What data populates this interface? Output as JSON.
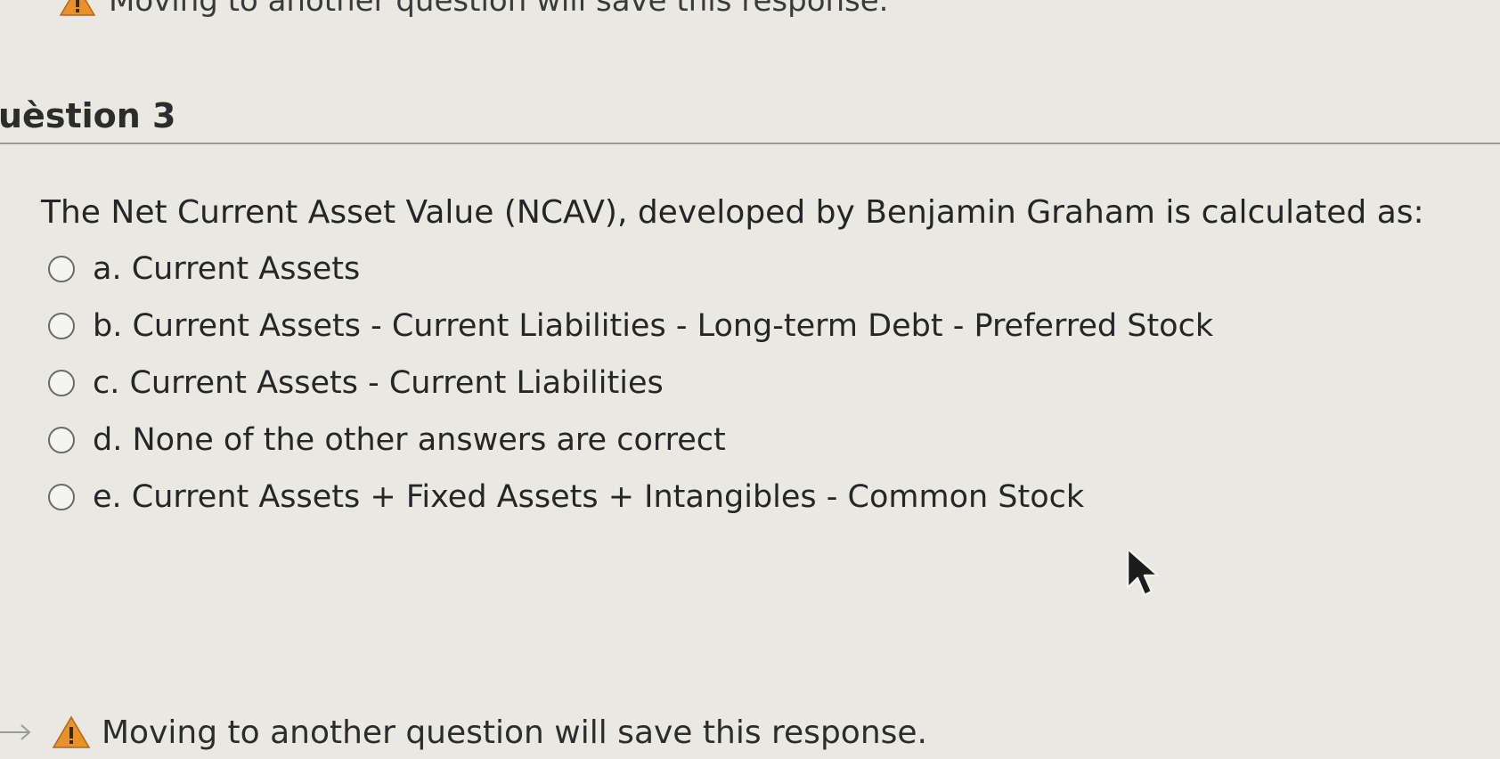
{
  "top_warning": {
    "icon": "warning-triangle-icon",
    "text": "Moving to another question will save this response."
  },
  "question": {
    "title": "uèstion 3",
    "text": "The Net Current Asset Value (NCAV), developed by Benjamin Graham is calculated as:",
    "options": [
      {
        "label": "a. Current Assets"
      },
      {
        "label": "b. Current Assets - Current Liabilities - Long-term Debt - Preferred Stock"
      },
      {
        "label": "c. Current Assets - Current Liabilities"
      },
      {
        "label": "d. None of the other answers are correct"
      },
      {
        "label": "e. Current Assets + Fixed Assets + Intangibles - Common Stock"
      }
    ]
  },
  "bottom_warning": {
    "icon": "warning-triangle-icon",
    "text": "Moving to another question will save this response."
  },
  "colors": {
    "background": "#e9e8e3",
    "warning_fill": "#e8922a",
    "text": "#252525"
  }
}
